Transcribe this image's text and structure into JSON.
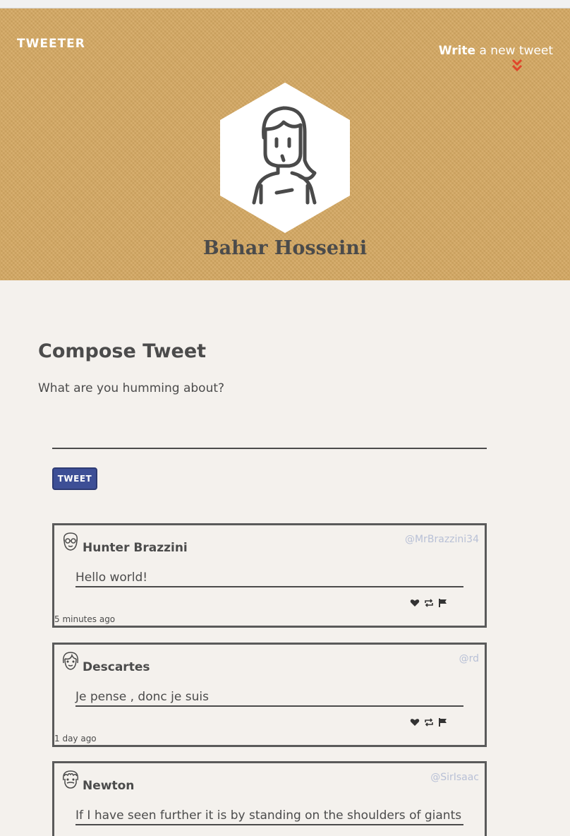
{
  "nav": {
    "brand": "TWEETER",
    "write_bold": "Write",
    "write_rest": " a new tweet"
  },
  "profile": {
    "name": "Bahar Hosseini"
  },
  "compose": {
    "title": "Compose Tweet",
    "prompt": "What are you humming about?",
    "input_value": "",
    "button_label": "TWEET"
  },
  "tweets": [
    {
      "author": "Hunter Brazzini",
      "handle": "@MrBrazzini34",
      "text": "Hello world!",
      "time": "5 minutes ago",
      "avatar_icon": "glasses-face-icon"
    },
    {
      "author": "Descartes",
      "handle": "@rd",
      "text": "Je pense , donc je suis",
      "time": "1 day ago",
      "avatar_icon": "girl-face-icon"
    },
    {
      "author": "Newton",
      "handle": "@SirIsaac",
      "text": "If I have seen further it is by standing on the shoulders of giants",
      "time": "",
      "avatar_icon": "bearded-face-icon"
    }
  ],
  "colors": {
    "hero_bg": "#d4a862",
    "accent_red": "#e0462b",
    "button_blue": "#3d4f96",
    "handle_gray": "#b8c0d6"
  }
}
